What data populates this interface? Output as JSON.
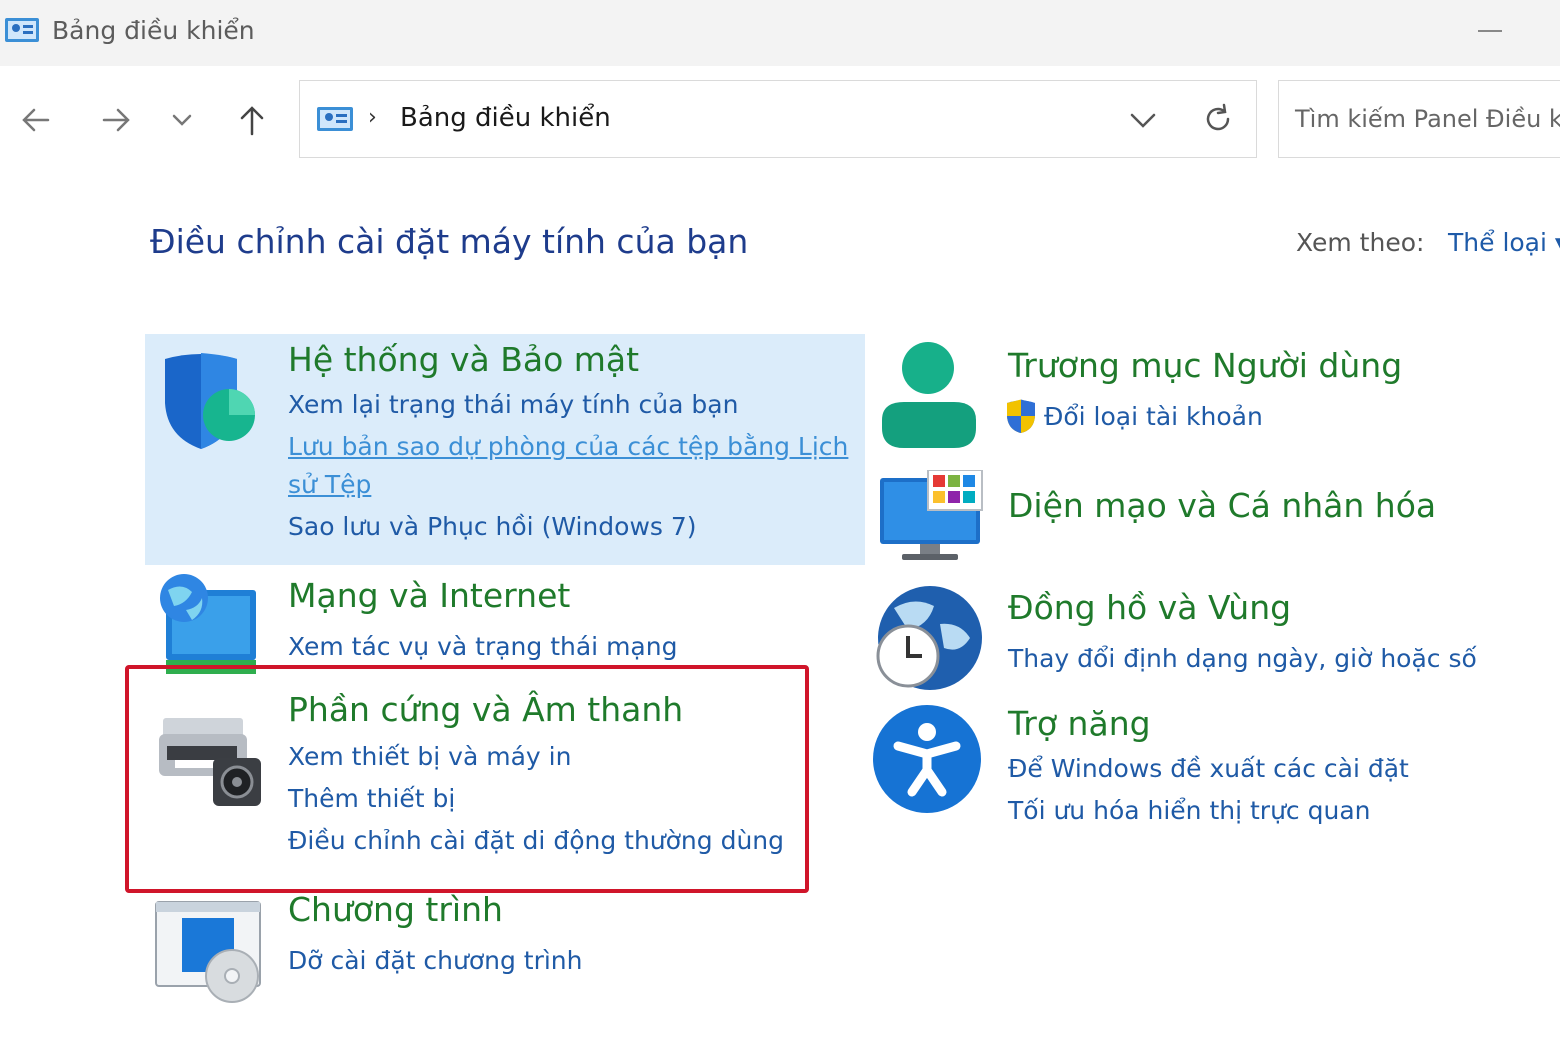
{
  "window": {
    "title": "Bảng điều khiển"
  },
  "nav": {
    "back_icon": "arrow-left-icon",
    "forward_icon": "arrow-right-icon",
    "recent_icon": "chevron-down-icon",
    "up_icon": "arrow-up-icon"
  },
  "address": {
    "separator": "›",
    "path": "Bảng điều khiển"
  },
  "search": {
    "placeholder": "Tìm kiếm Panel Điều kh"
  },
  "main": {
    "heading": "Điều chỉnh cài đặt máy tính của bạn",
    "view_by_label": "Xem theo:",
    "view_by_value": "Thể loại ▾"
  },
  "categories": [
    {
      "title": "Hệ thống và Bảo mật",
      "icon": "security-shield-icon",
      "links": [
        "Xem lại trạng thái máy tính của bạn",
        "Lưu bản sao dự phòng của các tệp bằng Lịch ",
        "sử Tệp",
        "Sao lưu và Phục hồi (Windows 7)"
      ]
    },
    {
      "title": "Mạng và Internet",
      "icon": "network-globe-icon",
      "links": [
        "Xem tác vụ và trạng thái mạng"
      ]
    },
    {
      "title": "Phần cứng và Âm thanh",
      "icon": "printer-speaker-icon",
      "links": [
        "Xem thiết bị và máy in",
        "Thêm thiết bị",
        "Điều chỉnh cài đặt di động thường dùng"
      ]
    },
    {
      "title": "Chương trình",
      "icon": "programs-disc-icon",
      "links": [
        "Dỡ cài đặt chương trình"
      ]
    },
    {
      "title": "Trương mục Người dùng",
      "icon": "user-accounts-icon",
      "links": [
        "Đổi loại tài khoản"
      ]
    },
    {
      "title": "Diện mạo và Cá nhân hóa",
      "icon": "monitor-personalize-icon",
      "links": []
    },
    {
      "title": "Đồng hồ và Vùng",
      "icon": "globe-clock-icon",
      "links": [
        "Thay đổi định dạng ngày, giờ hoặc số"
      ]
    },
    {
      "title": "Trợ năng",
      "icon": "accessibility-icon",
      "links": [
        "Để Windows đề xuất các cài đặt",
        "Tối ưu hóa hiển thị trực quan"
      ]
    }
  ],
  "colors": {
    "heading": "#1e3c8c",
    "category_title": "#1f7a2b",
    "link": "#1f5aa6",
    "highlight": "#dbecfa",
    "annotation_box": "#d0152a"
  }
}
